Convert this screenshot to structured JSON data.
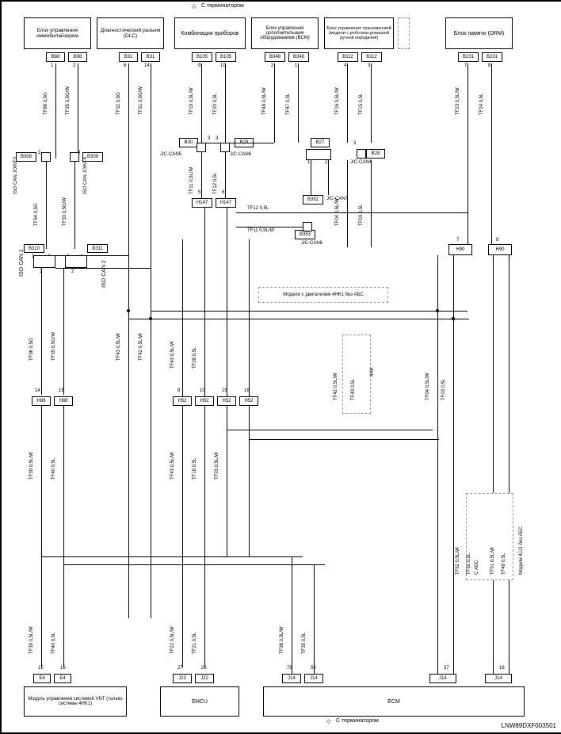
{
  "title_top": "С терминатором",
  "title_bottom": "С терминатором",
  "diagram_id": "LNW89DXF003501",
  "blocks": {
    "b1": "Блок управления иммобилайзером",
    "b2": "Диагностический разъем (DLC)",
    "b3": "Комбинация приборов",
    "b4": "Блок управления дополнительным оборудованием (BCM)",
    "b5": "Блок управления трансмиссией (модели с роботизи-рованной ручной передачей)",
    "b6": "Блок памяти (DRM)",
    "bottom1": "Модуль управления системой VNT (только системы 4HK1)",
    "bottom2": "EHCU",
    "bottom3": "ECM"
  },
  "connectors": {
    "b88a": "B88",
    "b88b": "B88",
    "b31a": "B31",
    "b31b": "B31",
    "b105a": "B105",
    "b105b": "B105",
    "b348a": "B348",
    "b348b": "B348",
    "b112a": "B112",
    "b112b": "B112",
    "b231a": "B231",
    "b231b": "B231",
    "b308": "B308",
    "b309": "B309",
    "b310": "B310",
    "b311": "B311",
    "b30": "B30",
    "b29": "B29",
    "b27": "B27",
    "b28": "B28",
    "b352": "B352",
    "b353": "B353",
    "h147a": "H147",
    "h147b": "H147",
    "h88a": "H88",
    "h88b": "H88",
    "h52a": "H52",
    "h52b": "H52",
    "h52c": "H52",
    "h52d": "H52",
    "h90a": "H90",
    "h90b": "H90",
    "e4a": "E4",
    "e4b": "E4",
    "j22a": "J22",
    "j22b": "J22",
    "j14a": "J14",
    "j14b": "J14",
    "j14c": "J14",
    "j14d": "J14"
  },
  "joints": {
    "iso1": "ISO CAN JOINT3",
    "iso2": "ISO CAN JOINT4",
    "iso3": "ISO CAN 1",
    "iso4": "ISO CAN 2",
    "jc5": "J/C-CAN5",
    "jc6": "J/C-CAN6",
    "jc7": "J/C-CAN7",
    "jc4": "J/C-CAN4",
    "jc8": "J/C-CAN8"
  },
  "wires": {
    "tf86": "TF86 0,5G",
    "tf35": "TF35 0,5G/W",
    "tf32": "TF32 0,5G",
    "tf31": "TF31 0,5G/W",
    "tf19": "TF19 0,5L/W",
    "tf20": "TF20 0,5L",
    "tf48": "TF48 0,5L/W",
    "tf47": "TF47 0,5L",
    "tf16": "TF16 0,5L/W",
    "tf15": "TF15 0,5L",
    "tf23": "TF23 0,5L/W",
    "tf24": "TF24 0,5L",
    "tf34": "TF34 0,5G",
    "tf33": "TF33 0,5G/W",
    "tf11h": "TF11 0,5L/W",
    "tf12h": "TF12 0,5L",
    "tf11": "TF11 0,5L/W",
    "tf12": "TF12 0,5L",
    "tf04a": "TF04 0,5L/W",
    "tf03a": "TF03 0,5L",
    "tf36": "TF36 0,5G",
    "tf35b": "TF35 0,5G/W",
    "tf43a": "TF43 0,5L/W",
    "tf28a": "TF28 0,5L",
    "tf42a": "TF42 0,5L/W",
    "tf43b": "TF43 0,5L",
    "tf39a": "TF39 0,5L/W",
    "tf40a": "TF40 0,5L",
    "tf04b": "TF04 0,5L/W",
    "tf03b": "TF03 0,5L",
    "tf43c": "TF43 0,5L/W",
    "tf18b": "TF18 0,5L",
    "tf03c": "TF03 0,5L/W",
    "tf22": "TF22 0,5L/W",
    "tf21": "TF21 0,5L",
    "tf36b": "TF36 0,5L/W",
    "tf35c": "TF35 0,5L",
    "tf52": "TF52 0,5L/W",
    "tf50a": "TF50 0,5L",
    "tf51": "TF51 0,5L/W",
    "tf49": "TF49 0,5L",
    "abs_note1": "Модели с двигателем 4HK1 без АБС",
    "abs_note2": "Модели 4JJ1 без АБС",
    "abs_note3": "С АБС",
    "hk_label": "4HK"
  }
}
